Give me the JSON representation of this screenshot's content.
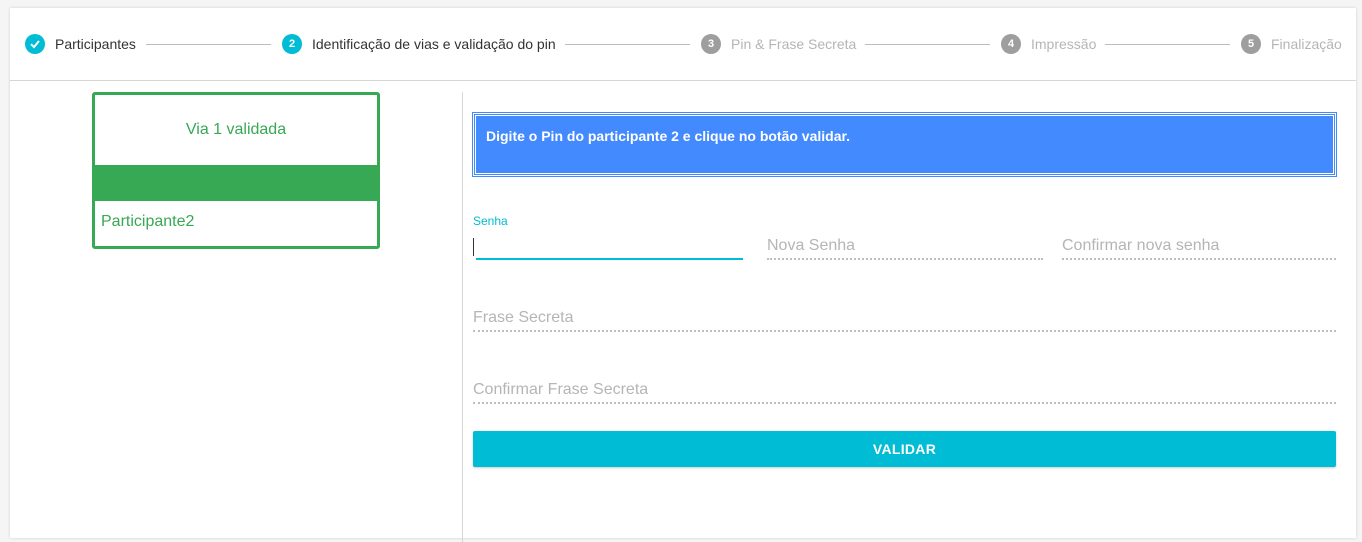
{
  "stepper": {
    "steps": [
      {
        "number": "✓",
        "label": "Participantes",
        "state": "done"
      },
      {
        "number": "2",
        "label": "Identificação de vias e validação do pin",
        "state": "active"
      },
      {
        "number": "3",
        "label": "Pin & Frase Secreta",
        "state": "pending"
      },
      {
        "number": "4",
        "label": "Impressão",
        "state": "pending"
      },
      {
        "number": "5",
        "label": "Finalização",
        "state": "pending"
      }
    ]
  },
  "via_card": {
    "status": "Via 1 validada",
    "participant": "Participante2"
  },
  "banner": {
    "text": "Digite o Pin do participante 2 e clique no botão validar."
  },
  "form": {
    "senha_label": "Senha",
    "senha_value": "",
    "nova_senha_placeholder": "Nova Senha",
    "confirmar_nova_senha_placeholder": "Confirmar nova senha",
    "frase_secreta_placeholder": "Frase Secreta",
    "confirmar_frase_secreta_placeholder": "Confirmar Frase Secreta",
    "validar_label": "VALIDAR"
  },
  "colors": {
    "accent": "#00bcd4",
    "success": "#37a853",
    "info": "#448aff",
    "pending": "#9e9e9e"
  }
}
